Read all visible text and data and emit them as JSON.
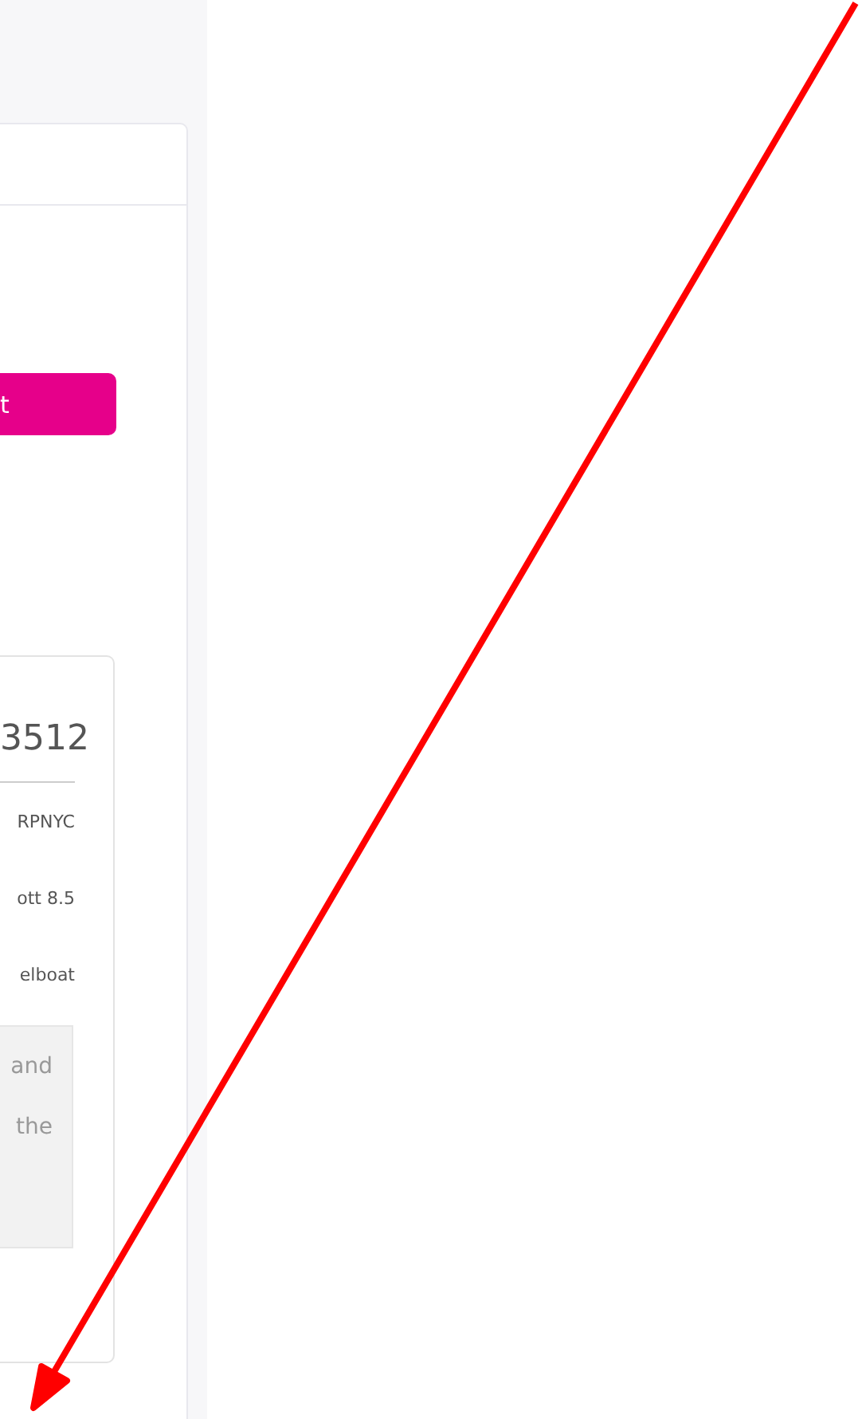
{
  "button": {
    "label": "t"
  },
  "record": {
    "title": "3512",
    "fields": [
      "RPNYC",
      "ott 8.5",
      "elboat"
    ],
    "note_lines": [
      "and",
      "the"
    ]
  },
  "annotation": {
    "kind": "arrow"
  }
}
